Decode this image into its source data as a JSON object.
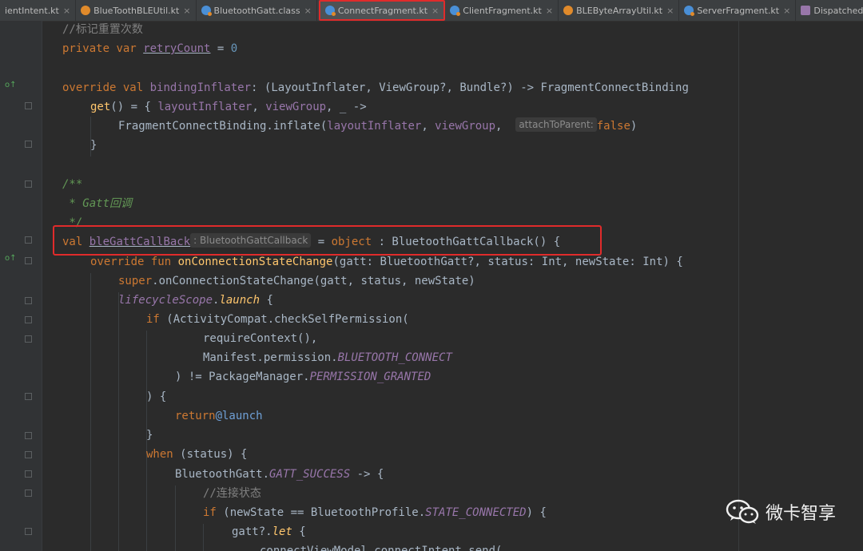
{
  "tabs": [
    {
      "label": "ientIntent.kt",
      "icon": "none",
      "active": false
    },
    {
      "label": "BlueToothBLEUtil.kt",
      "icon": "util",
      "active": false
    },
    {
      "label": "BluetoothGatt.class",
      "icon": "kt",
      "active": false
    },
    {
      "label": "ConnectFragment.kt",
      "icon": "kt",
      "active": true
    },
    {
      "label": "ClientFragment.kt",
      "icon": "kt",
      "active": false
    },
    {
      "label": "BLEByteArrayUtil.kt",
      "icon": "util",
      "active": false
    },
    {
      "label": "ServerFragment.kt",
      "icon": "kt",
      "active": false
    },
    {
      "label": "DispatchedContinuationKt.class",
      "icon": "cls",
      "active": false
    }
  ],
  "code": {
    "l1": {
      "comment": "//标记重置次数"
    },
    "l2": {
      "kw1": "private",
      "kw2": "var",
      "name": "retryCount",
      "eq": " = ",
      "num": "0"
    },
    "l4": {
      "kw1": "override",
      "kw2": "val",
      "name": "bindingInflater",
      "rest1": ": (LayoutInflater, ViewGroup?, Bundle?) -> FragmentConnectBinding"
    },
    "l5": {
      "fn": "get",
      "pre": "() = { ",
      "p1": "layoutInflater",
      "c1": ", ",
      "p2": "viewGroup",
      "rest": ", _ ->"
    },
    "l6": {
      "head": "FragmentConnectBinding.inflate(",
      "p1": "layoutInflater",
      "c1": ", ",
      "p2": "viewGroup",
      "c2": ", ",
      "hint": "attachToParent:",
      "kw": "false",
      "close": ")"
    },
    "l7": {
      "brace": "}"
    },
    "l9": {
      "doc": "/**"
    },
    "l10": {
      "doc": " * Gatt回调"
    },
    "l11": {
      "doc": " */"
    },
    "l12": {
      "kw1": "val",
      "name": "bleGattCallBack",
      "hint": ": BluetoothGattCallback",
      "eq": " = ",
      "kw2": "object",
      "rest": " : BluetoothGattCallback() {"
    },
    "l13": {
      "kw1": "override",
      "kw2": "fun",
      "fn": "onConnectionStateChange",
      "a": "(gatt: BluetoothGatt?, status: Int, newState: Int) {"
    },
    "l14": {
      "kw": "super",
      "rest": ".onConnectionStateChange(gatt, status, newState)"
    },
    "l15": {
      "p1": "lifecycleScope",
      "dot": ".",
      "p2": "launch",
      "rest": " {"
    },
    "l16": {
      "kw": "if",
      "rest": " (ActivityCompat.checkSelfPermission("
    },
    "l17": {
      "fn": "requireContext",
      "rest": "(),"
    },
    "l18": {
      "head": "Manifest.permission.",
      "stat": "BLUETOOTH_CONNECT"
    },
    "l19": {
      "head": ") != PackageManager.",
      "stat": "PERMISSION_GRANTED"
    },
    "l20": {
      "text": ") {"
    },
    "l21": {
      "kw": "return",
      "lbl": "@launch"
    },
    "l22": {
      "brace": "}"
    },
    "l23": {
      "kw": "when",
      "rest": " (status) {"
    },
    "l24": {
      "head": "BluetoothGatt.",
      "stat": "GATT_SUCCESS",
      "rest": " -> {"
    },
    "l25": {
      "comment": "//连接状态"
    },
    "l26": {
      "kw": "if",
      "mid": " (newState == BluetoothProfile.",
      "stat": "STATE_CONNECTED",
      "rest": ") {"
    },
    "l27": {
      "head": "gatt?.",
      "fn": "let",
      "rest": " {"
    },
    "l28": {
      "text": "connectViewModel.connectIntent.send("
    }
  },
  "watermark": {
    "text": "微卡智享",
    "icon": "wechat-logo-icon"
  }
}
